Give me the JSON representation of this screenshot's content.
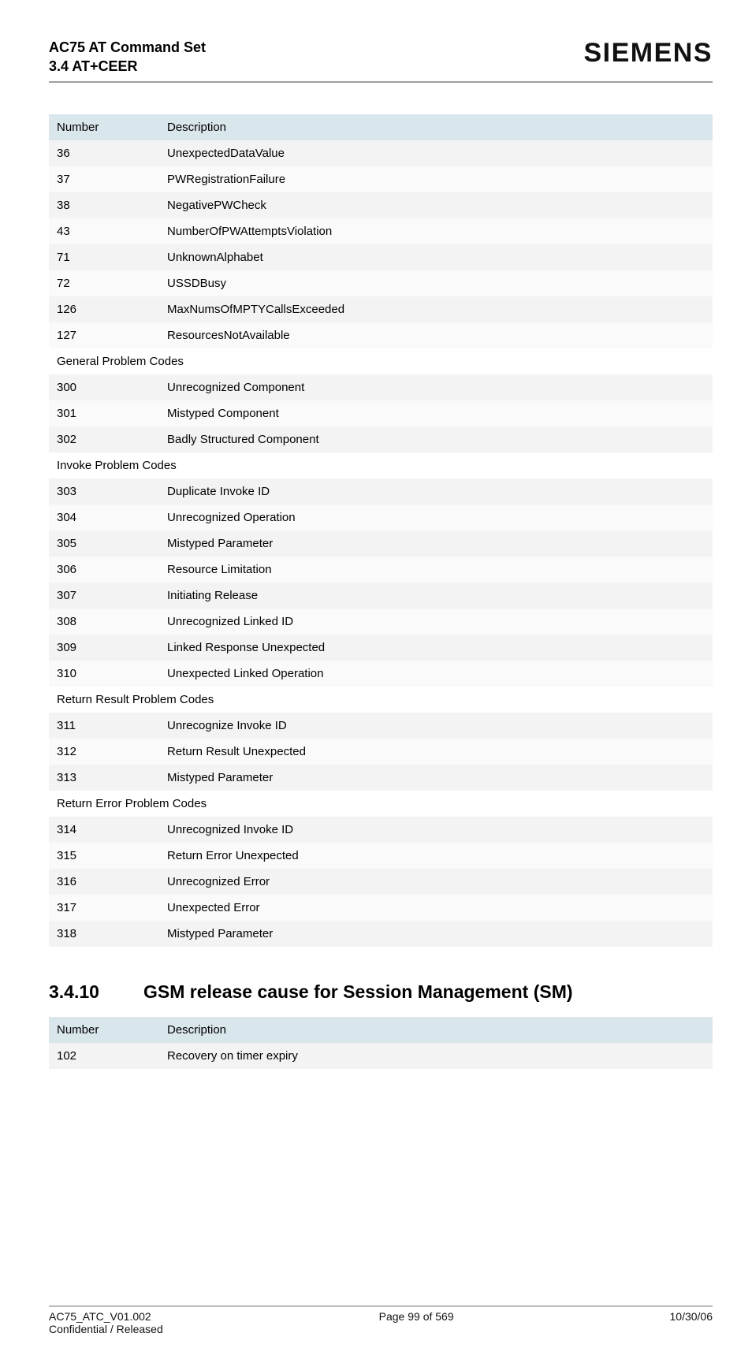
{
  "header": {
    "title_line1": "AC75 AT Command Set",
    "title_line2": "3.4 AT+CEER",
    "brand": "SIEMENS"
  },
  "table1": {
    "headers": [
      "Number",
      "Description"
    ],
    "rows": [
      {
        "type": "row",
        "cells": [
          "36",
          "UnexpectedDataValue"
        ]
      },
      {
        "type": "row",
        "cells": [
          "37",
          "PWRegistrationFailure"
        ]
      },
      {
        "type": "row",
        "cells": [
          "38",
          "NegativePWCheck"
        ]
      },
      {
        "type": "row",
        "cells": [
          "43",
          "NumberOfPWAttemptsViolation"
        ]
      },
      {
        "type": "row",
        "cells": [
          "71",
          "UnknownAlphabet"
        ]
      },
      {
        "type": "row",
        "cells": [
          "72",
          "USSDBusy"
        ]
      },
      {
        "type": "row",
        "cells": [
          "126",
          "MaxNumsOfMPTYCallsExceeded"
        ]
      },
      {
        "type": "row",
        "cells": [
          "127",
          "ResourcesNotAvailable"
        ]
      },
      {
        "type": "section",
        "label": "General Problem Codes"
      },
      {
        "type": "row",
        "cells": [
          "300",
          "Unrecognized Component"
        ]
      },
      {
        "type": "row",
        "cells": [
          "301",
          "Mistyped Component"
        ]
      },
      {
        "type": "row",
        "cells": [
          "302",
          "Badly Structured Component"
        ]
      },
      {
        "type": "section",
        "label": "Invoke Problem Codes"
      },
      {
        "type": "row",
        "cells": [
          "303",
          "Duplicate Invoke ID"
        ]
      },
      {
        "type": "row",
        "cells": [
          "304",
          "Unrecognized Operation"
        ]
      },
      {
        "type": "row",
        "cells": [
          "305",
          "Mistyped Parameter"
        ]
      },
      {
        "type": "row",
        "cells": [
          "306",
          "Resource Limitation"
        ]
      },
      {
        "type": "row",
        "cells": [
          "307",
          "Initiating Release"
        ]
      },
      {
        "type": "row",
        "cells": [
          "308",
          "Unrecognized Linked ID"
        ]
      },
      {
        "type": "row",
        "cells": [
          "309",
          "Linked Response Unexpected"
        ]
      },
      {
        "type": "row",
        "cells": [
          "310",
          "Unexpected Linked Operation"
        ]
      },
      {
        "type": "section",
        "label": "Return Result Problem Codes"
      },
      {
        "type": "row",
        "cells": [
          "311",
          "Unrecognize Invoke ID"
        ]
      },
      {
        "type": "row",
        "cells": [
          "312",
          "Return Result Unexpected"
        ]
      },
      {
        "type": "row",
        "cells": [
          "313",
          "Mistyped Parameter"
        ]
      },
      {
        "type": "section",
        "label": "Return Error Problem Codes"
      },
      {
        "type": "row",
        "cells": [
          "314",
          "Unrecognized Invoke ID"
        ]
      },
      {
        "type": "row",
        "cells": [
          "315",
          "Return Error Unexpected"
        ]
      },
      {
        "type": "row",
        "cells": [
          "316",
          "Unrecognized Error"
        ]
      },
      {
        "type": "row",
        "cells": [
          "317",
          "Unexpected Error"
        ]
      },
      {
        "type": "row",
        "cells": [
          "318",
          "Mistyped Parameter"
        ]
      }
    ]
  },
  "section_heading": {
    "number": "3.4.10",
    "title": "GSM release cause for Session Management (SM)"
  },
  "table2": {
    "headers": [
      "Number",
      "Description"
    ],
    "rows": [
      {
        "type": "row",
        "cells": [
          "102",
          "Recovery on timer expiry"
        ]
      }
    ]
  },
  "footer": {
    "left_line1": "AC75_ATC_V01.002",
    "left_line2": "Confidential / Released",
    "center": "Page 99 of 569",
    "right": "10/30/06"
  }
}
